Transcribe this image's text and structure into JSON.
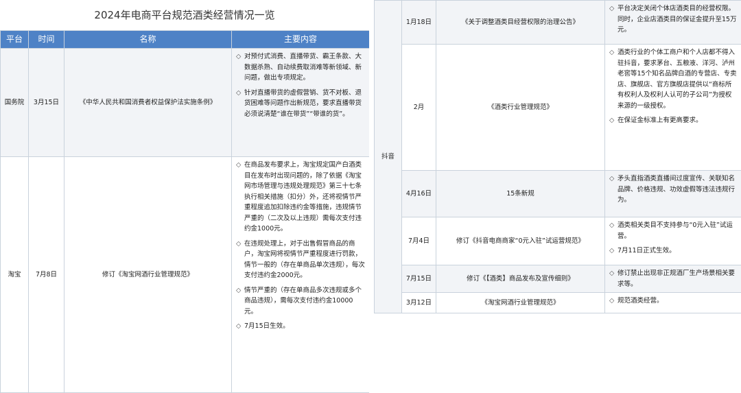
{
  "title": "2024年电商平台规范酒类经营情况一览",
  "headers": [
    "平台",
    "时间",
    "名称",
    "主要内容"
  ],
  "left_rows": [
    {
      "platform": "国务院",
      "time": "3月15日",
      "name": "《中华人民共和国消费者权益保护法实施条例》",
      "items": [
        "对预付式消费、直播带货、霸王条款、大数据杀熟、自动续费取消难等新领域、新问题，做出专项规定。",
        "针对直播带货的虚假营销、货不对板、退货困难等问题作出新规范，要求直播带货必须说清楚“谁在带货”“带谁的货”。"
      ]
    },
    {
      "platform": "淘宝",
      "time": "7月8日",
      "name": "修订《淘宝网酒行业管理规范》",
      "items": [
        "在商品发布要求上，淘宝规定国产白酒类目在发布时出现问题的，除了依据《淘宝网市场管理与违规处理规范》第三十七条执行相关措施（扣分）外，还将视情节严重程度追加扣除违约金等措施，违规情节严重的（二次及以上违规）需每次支付违约金1000元。",
        "在违规处理上，对于出售假冒商品的商户，淘宝网将视情节严重程度进行罚款，情节一般的（存在单商品单次违规），每次支付违约金2000元。",
        "情节严重的（存在单商品多次违规或多个商品违规），需每次支付违约金10000元。",
        "7月15日生效。"
      ]
    }
  ],
  "right_platform": "抖音",
  "right_rows": [
    {
      "time": "1月18日",
      "name": "《关于调整酒类目经营权限的治理公告》",
      "items": [
        "平台决定关闭个体店酒类目的经营权限。同时，企业店酒类目的保证金提升至15万元。"
      ]
    },
    {
      "time": "2月",
      "name": "《酒类行业管理规范》",
      "items": [
        "酒类行业的个体工商户和个人店都不得入驻抖音，要求茅台、五粮液、洋河、泸州老窖等15个知名品牌白酒的专营店、专卖店、旗舰店、官方旗舰店提供以“商标所有权利人及权利人认可的子公司”为授权来源的一级授权。",
        "在保证金标准上有更高要求。"
      ]
    },
    {
      "time": "4月16日",
      "name": "15条新规",
      "items": [
        "矛头直指酒类直播间过度宣传、关联知名品牌、价格违规、功效虚假等违法违规行为。"
      ]
    },
    {
      "time": "7月4日",
      "name": "修订《抖音电商商家“0元入驻”试运营规范》",
      "items": [
        "酒类相关类目不支持参与“0元入驻”试运营。",
        "7月11日正式生效。"
      ]
    },
    {
      "time": "7月15日",
      "name": "修订《【酒类】商品发布及宣传细则》",
      "items": [
        "修订禁止出现非正规酒厂生产场景相关要求等。"
      ]
    },
    {
      "time": "3月12日",
      "name": "《淘宝网酒行业管理规范》",
      "items": [
        "规范酒类经营。"
      ]
    }
  ],
  "icons": {
    "bullet": "◇"
  },
  "colors": {
    "header_bg": "#4e82c6",
    "row_alt_bg": "#f2f4f7",
    "border": "#c9d2dc"
  }
}
